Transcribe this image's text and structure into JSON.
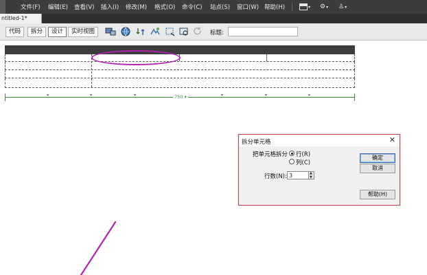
{
  "menubar": {
    "items": [
      "文件(F)",
      "编辑(E)",
      "查看(V)",
      "插入(I)",
      "修改(M)",
      "格式(O)",
      "命令(C)",
      "站点(S)",
      "窗口(W)",
      "帮助(H)"
    ],
    "icons": [
      "layout-icon",
      "gear-icon",
      "user-icon"
    ]
  },
  "tab": {
    "name": "ntitled-1*"
  },
  "toolbar": {
    "view_buttons": [
      "代码",
      "拆分",
      "设计",
      "实时视图"
    ],
    "active_view": "设计",
    "title_label": "标题:",
    "title_value": ""
  },
  "design": {
    "width_label": "750"
  },
  "dialog": {
    "title": "拆分单元格",
    "close_glyph": "✕",
    "split_label": "把单元格拆分",
    "option_rows": "行(R)",
    "option_cols": "列(C)",
    "selected_option": "rows",
    "count_label": "行数(N):",
    "count_value": "3",
    "ok": "确定",
    "cancel": "取消",
    "help": "帮助(H)"
  },
  "colors": {
    "menubar_bg": "#3c3c3c",
    "annotation": "#b421b4",
    "width_guide": "#3a8a3a"
  }
}
